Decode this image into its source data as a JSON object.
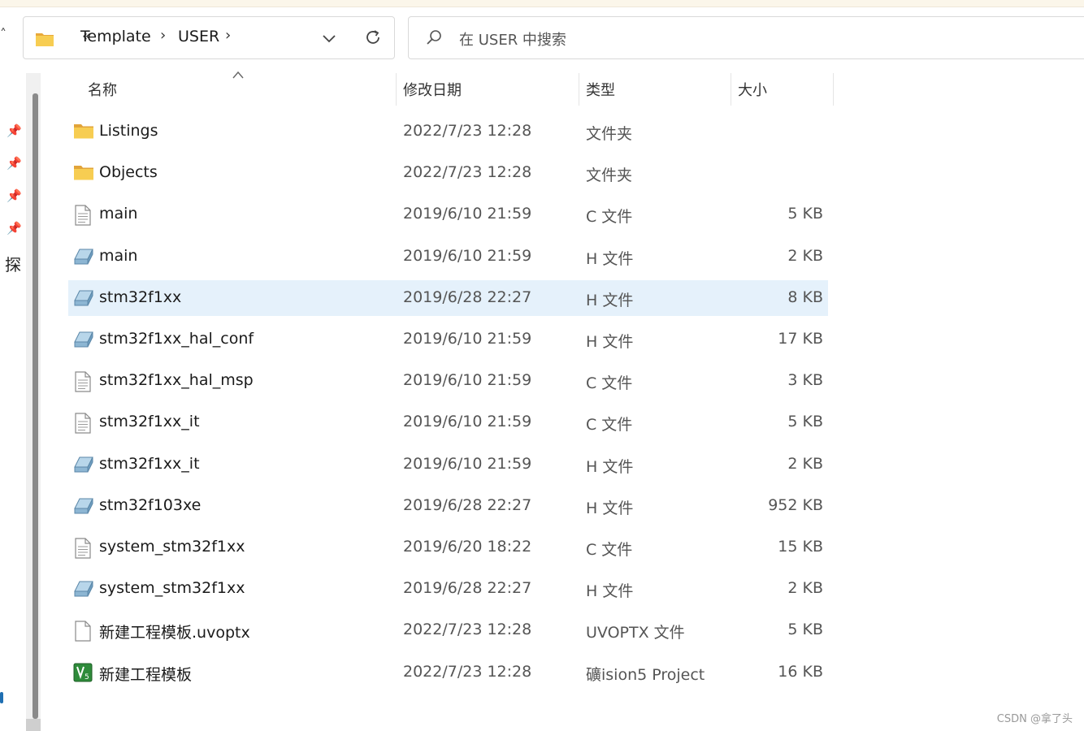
{
  "address_bar": {
    "overflow": "«",
    "crumbs": [
      "Template",
      "USER"
    ],
    "separator": "›"
  },
  "search": {
    "placeholder": "在 USER 中搜索"
  },
  "nav_pane": {
    "partial_label": "探"
  },
  "columns": {
    "name": "名称",
    "date": "修改日期",
    "type": "类型",
    "size": "大小"
  },
  "files": [
    {
      "name": "Listings",
      "date": "2022/7/23 12:28",
      "type": "文件夹",
      "size": "",
      "icon": "folder-icon"
    },
    {
      "name": "Objects",
      "date": "2022/7/23 12:28",
      "type": "文件夹",
      "size": "",
      "icon": "folder-icon"
    },
    {
      "name": "main",
      "date": "2019/6/10 21:59",
      "type": "C 文件",
      "size": "5 KB",
      "icon": "text-file-icon"
    },
    {
      "name": "main",
      "date": "2019/6/10 21:59",
      "type": "H 文件",
      "size": "2 KB",
      "icon": "header-file-icon"
    },
    {
      "name": "stm32f1xx",
      "date": "2019/6/28 22:27",
      "type": "H 文件",
      "size": "8 KB",
      "icon": "header-file-icon"
    },
    {
      "name": "stm32f1xx_hal_conf",
      "date": "2019/6/10 21:59",
      "type": "H 文件",
      "size": "17 KB",
      "icon": "header-file-icon"
    },
    {
      "name": "stm32f1xx_hal_msp",
      "date": "2019/6/10 21:59",
      "type": "C 文件",
      "size": "3 KB",
      "icon": "text-file-icon"
    },
    {
      "name": "stm32f1xx_it",
      "date": "2019/6/10 21:59",
      "type": "C 文件",
      "size": "5 KB",
      "icon": "text-file-icon"
    },
    {
      "name": "stm32f1xx_it",
      "date": "2019/6/10 21:59",
      "type": "H 文件",
      "size": "2 KB",
      "icon": "header-file-icon"
    },
    {
      "name": "stm32f103xe",
      "date": "2019/6/28 22:27",
      "type": "H 文件",
      "size": "952 KB",
      "icon": "header-file-icon"
    },
    {
      "name": "system_stm32f1xx",
      "date": "2019/6/20 18:22",
      "type": "C 文件",
      "size": "15 KB",
      "icon": "text-file-icon"
    },
    {
      "name": "system_stm32f1xx",
      "date": "2019/6/28 22:27",
      "type": "H 文件",
      "size": "2 KB",
      "icon": "header-file-icon"
    },
    {
      "name": "新建工程模板.uvoptx",
      "date": "2022/7/23 12:28",
      "type": "UVOPTX 文件",
      "size": "5 KB",
      "icon": "blank-file-icon"
    },
    {
      "name": "新建工程模板",
      "date": "2022/7/23 12:28",
      "type": "礦ision5 Project",
      "size": "16 KB",
      "icon": "uvision-project-icon"
    }
  ],
  "selected_index": 4,
  "watermark": "CSDN @拿了头",
  "colors": {
    "selection": "#e5f1fb",
    "folder": "#f5c542"
  }
}
